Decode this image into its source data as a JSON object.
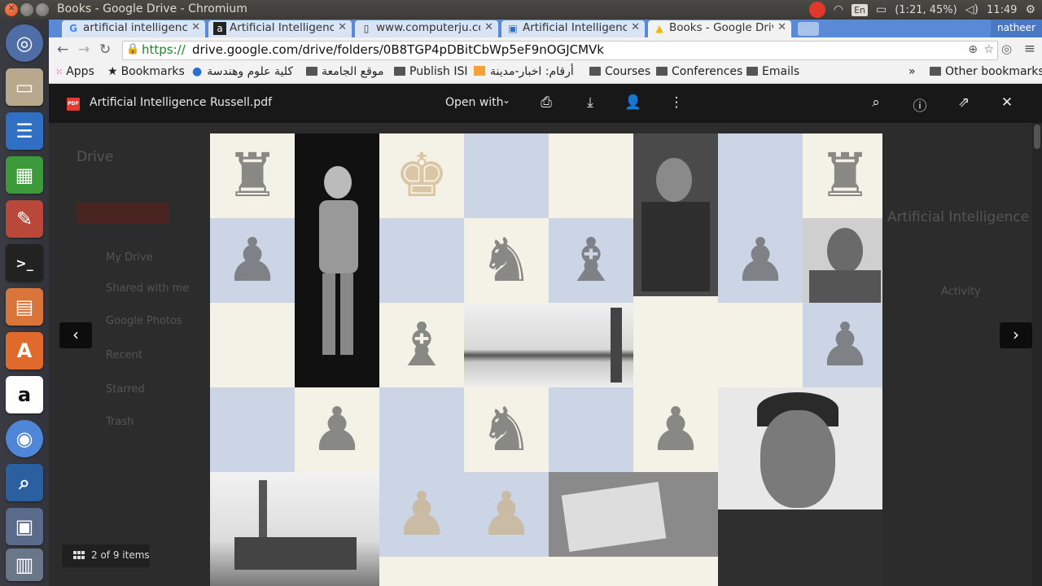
{
  "os": {
    "window_title": "Books - Google Drive - Chromium",
    "tray": {
      "keyboard": "En",
      "battery": "(1:21, 45%)",
      "clock": "11:49"
    }
  },
  "tabs": [
    {
      "icon": "G",
      "title": "artificial intelligence",
      "active": false
    },
    {
      "icon": "a",
      "title": "Artificial Intelligence",
      "active": false
    },
    {
      "icon": "▯",
      "title": "www.computerju.com",
      "active": false
    },
    {
      "icon": "▣",
      "title": "Artificial Intelligence",
      "active": false
    },
    {
      "icon": "▲",
      "title": "Books - Google Drive",
      "active": true
    }
  ],
  "profile_name": "natheer",
  "address": {
    "scheme": "https://",
    "rest": "drive.google.com/drive/folders/0B8TGP4pDBitCbWp5eF9nOGJCMVk"
  },
  "bookmarks": [
    {
      "label": "Apps",
      "icon": "apps-grid-icon"
    },
    {
      "label": "Bookmarks",
      "icon": "star-icon"
    },
    {
      "label": "كلية علوم وهندسة",
      "icon": "globe-icon"
    },
    {
      "label": "موقع الجامعة",
      "icon": "folder-icon"
    },
    {
      "label": "Publish ISI",
      "icon": "folder-icon"
    },
    {
      "label": "أرقام: اخبار-مدينة",
      "icon": "news-icon"
    },
    {
      "label": "Courses",
      "icon": "folder-icon"
    },
    {
      "label": "Conferences",
      "icon": "folder-icon"
    },
    {
      "label": "Emails",
      "icon": "folder-icon"
    },
    {
      "label": "»",
      "icon": ""
    },
    {
      "label": "Other bookmarks",
      "icon": "folder-icon"
    }
  ],
  "viewer": {
    "file_badge": "PDF",
    "file_name": "Artificial Intelligence Russell.pdf",
    "open_with": "Open with",
    "position": "2 of 9 items"
  },
  "drive_background": {
    "logo": "Drive",
    "nav": [
      "My Drive",
      "Shared with me",
      "Google Photos",
      "Recent",
      "Starred",
      "Trash"
    ],
    "panel_title": "Artificial Intelligence",
    "panel_tab": "Activity"
  },
  "colors": {
    "accent_blue": "#5a8ad6",
    "viewer_bar": "#181818",
    "cover_light": "#f4f1e6",
    "cover_blue": "#ccd5e6"
  }
}
